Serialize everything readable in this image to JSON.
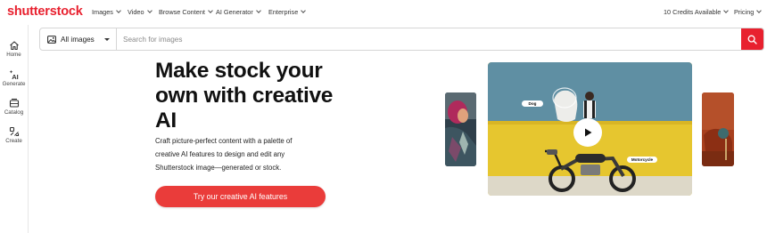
{
  "header": {
    "logo": "shutterstock",
    "nav": [
      "Images",
      "Video",
      "Browse Content",
      "AI Generator",
      "Enterprise"
    ],
    "credits": "10 Credits Available",
    "pricing": "Pricing"
  },
  "sidebar": {
    "items": [
      {
        "label": "Home",
        "icon": "home-icon"
      },
      {
        "label": "Generate",
        "icon": "ai-sparkle-icon"
      },
      {
        "label": "Catalog",
        "icon": "catalog-icon"
      },
      {
        "label": "Create",
        "icon": "create-icon"
      }
    ]
  },
  "search": {
    "type": "All images",
    "placeholder": "Search for images"
  },
  "hero": {
    "title": "Make stock your own with creative AI",
    "description": "Craft picture-perfect content with a palette of creative AI features to design and edit any Shutterstock image—generated or stock.",
    "cta": "Try our creative AI features"
  },
  "media": {
    "tags": [
      "Dog",
      "Motorcycle"
    ]
  },
  "colors": {
    "brand": "#e8212f",
    "cta": "#ea3c3a"
  }
}
